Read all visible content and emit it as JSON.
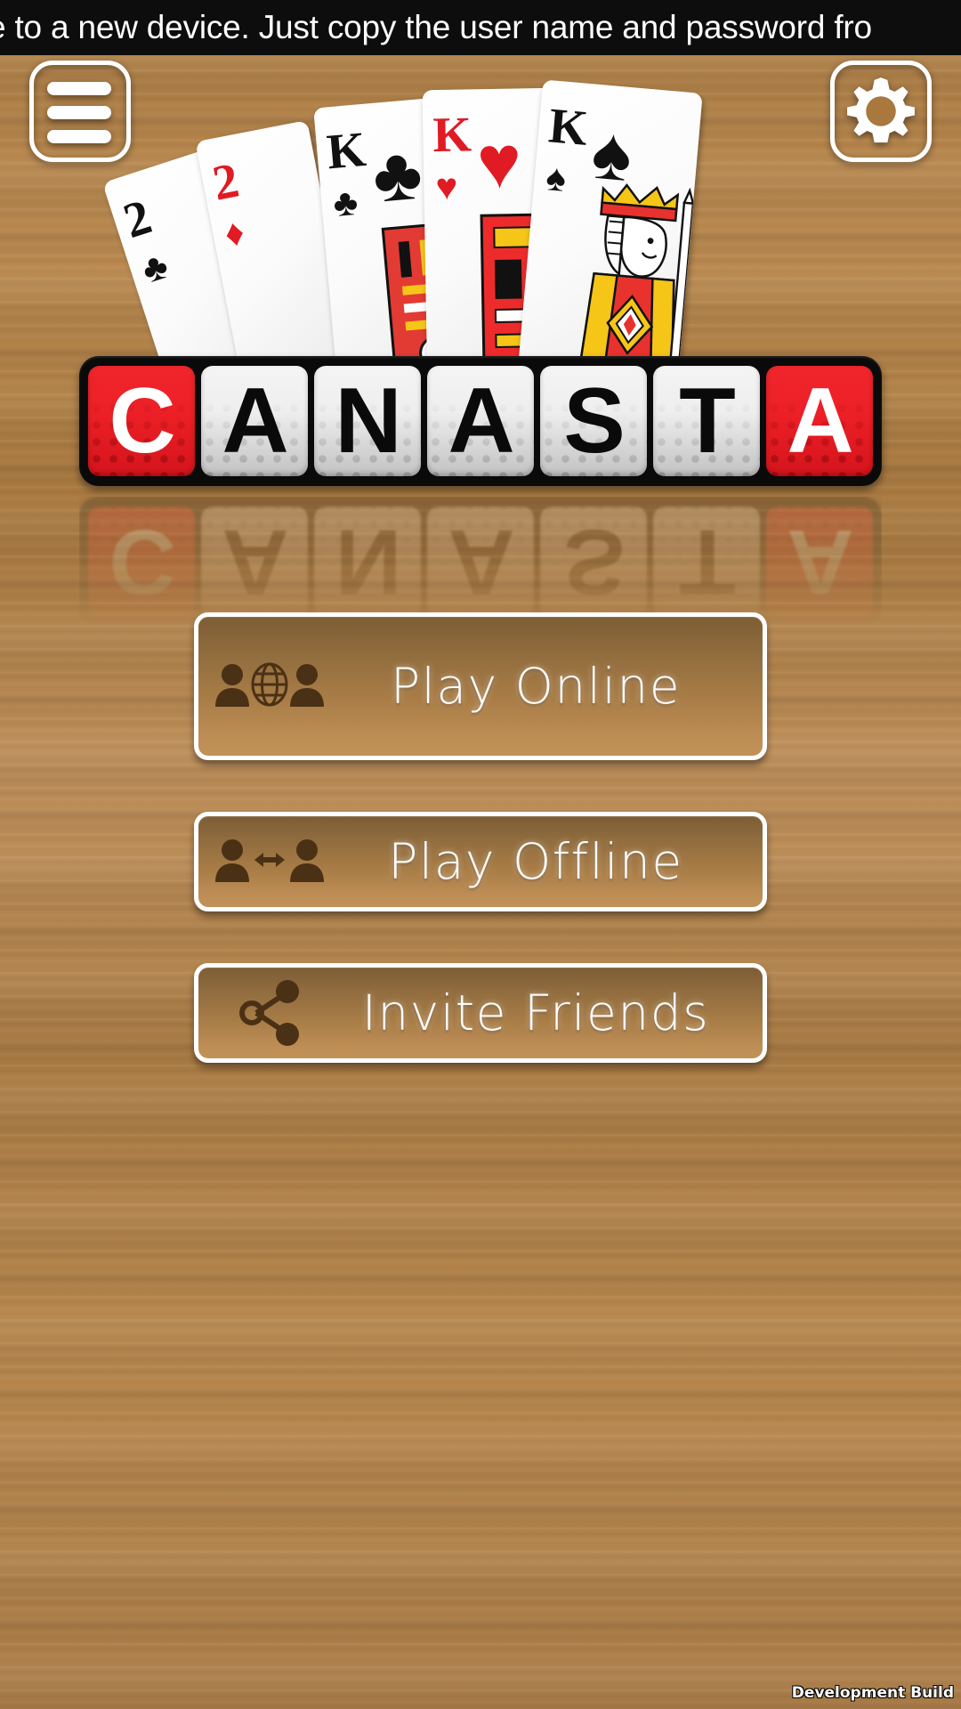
{
  "marquee": {
    "text": "e to a new device. Just copy the user name and password fro"
  },
  "top_bar": {
    "menu_button": {
      "name": "menu-button",
      "icon": "hamburger-menu-icon"
    },
    "settings_button": {
      "name": "settings-button",
      "icon": "gear-icon"
    }
  },
  "logo": {
    "title": "CANASTA",
    "tiles": [
      {
        "letter": "C",
        "style": "red"
      },
      {
        "letter": "A",
        "style": "grey"
      },
      {
        "letter": "N",
        "style": "grey"
      },
      {
        "letter": "A",
        "style": "grey"
      },
      {
        "letter": "S",
        "style": "grey"
      },
      {
        "letter": "T",
        "style": "grey"
      },
      {
        "letter": "A",
        "style": "red"
      }
    ],
    "colors": {
      "red": "#ec1f26",
      "grey": "#eeeeee",
      "frame": "#0a0a0a"
    }
  },
  "cards": [
    {
      "rank": "2",
      "suit": "♣",
      "color": "black"
    },
    {
      "rank": "2",
      "suit": "♦",
      "color": "red"
    },
    {
      "rank": "K",
      "suit": "♣",
      "color": "black"
    },
    {
      "rank": "K",
      "suit": "♥",
      "color": "red"
    },
    {
      "rank": "K",
      "suit": "♠",
      "color": "black"
    }
  ],
  "menu": {
    "buttons": [
      {
        "label": "Play Online",
        "icon": "two-people-globe-icon"
      },
      {
        "label": "Play Offline",
        "icon": "two-people-arrow-icon"
      },
      {
        "label": "Invite Friends",
        "icon": "share-nodes-icon"
      }
    ]
  },
  "watermark": {
    "text": "Development Build"
  },
  "theme": {
    "wood_light": "#c0905a",
    "wood_dark": "#a9793f",
    "button_top": "#7d5d35",
    "button_bottom": "#c09257",
    "border": "#ffffff",
    "banner_bg": "#0d0d0d",
    "card_red": "#e01b24",
    "card_black": "#111111"
  }
}
